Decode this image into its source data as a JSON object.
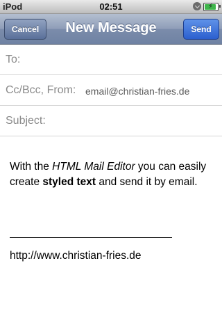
{
  "status_bar": {
    "carrier": "iPod",
    "time": "02:51",
    "battery_level": 0.9
  },
  "nav": {
    "title": "New Message",
    "cancel_label": "Cancel",
    "send_label": "Send"
  },
  "fields": {
    "to_label": "To:",
    "ccbcc_label": "Cc/Bcc, From:",
    "from_value": "email@christian-fries.de",
    "subject_label": "Subject:"
  },
  "body": {
    "part1": "With the ",
    "part2_italic": "HTML Mail Editor",
    "part3": " you can easily create ",
    "part4_bold": "styled text",
    "part5": " and send it by email.",
    "signature_url": "http://www.christian-fries.de"
  },
  "icons": [
    "lock-rotation-icon",
    "battery-charging-icon"
  ]
}
